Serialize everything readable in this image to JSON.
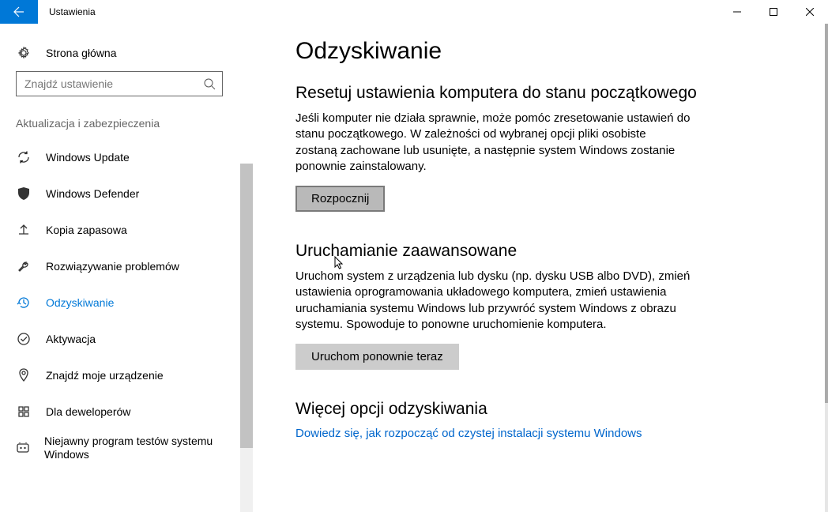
{
  "titlebar": {
    "title": "Ustawienia"
  },
  "sidebar": {
    "home_label": "Strona główna",
    "search_placeholder": "Znajdź ustawienie",
    "group_header": "Aktualizacja i zabezpieczenia",
    "items": [
      {
        "label": "Windows Update"
      },
      {
        "label": "Windows Defender"
      },
      {
        "label": "Kopia zapasowa"
      },
      {
        "label": "Rozwiązywanie problemów"
      },
      {
        "label": "Odzyskiwanie"
      },
      {
        "label": "Aktywacja"
      },
      {
        "label": "Znajdź moje urządzenie"
      },
      {
        "label": "Dla deweloperów"
      },
      {
        "label": "Niejawny program testów systemu Windows"
      }
    ]
  },
  "main": {
    "page_title": "Odzyskiwanie",
    "section1": {
      "title": "Resetuj ustawienia komputera do stanu początkowego",
      "desc": "Jeśli komputer nie działa sprawnie, może pomóc zresetowanie ustawień do stanu początkowego. W zależności od wybranej opcji pliki osobiste zostaną zachowane lub usunięte, a następnie system Windows zostanie ponownie zainstalowany.",
      "button": "Rozpocznij"
    },
    "section2": {
      "title": "Uruchamianie zaawansowane",
      "desc": "Uruchom system z urządzenia lub dysku (np. dysku USB albo DVD), zmień ustawienia oprogramowania układowego komputera, zmień ustawienia uruchamiania systemu Windows lub przywróć system Windows z obrazu systemu. Spowoduje to ponowne uruchomienie komputera.",
      "button": "Uruchom ponownie teraz"
    },
    "section3": {
      "title": "Więcej opcji odzyskiwania",
      "link": "Dowiedz się, jak rozpocząć od czystej instalacji systemu Windows"
    }
  }
}
